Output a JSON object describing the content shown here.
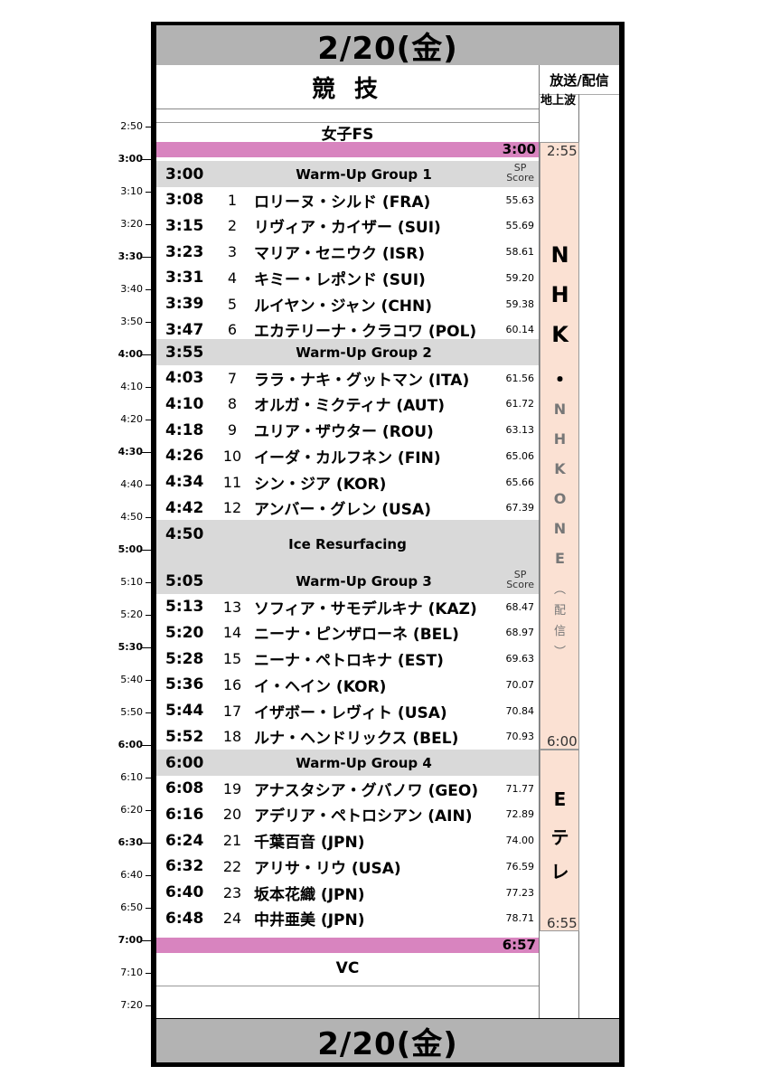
{
  "header": {
    "date_top": "2/20(金)",
    "date_bottom": "2/20(金)",
    "competition": "競 技",
    "broadcast": "放送/配信",
    "channel": "地上波"
  },
  "timeline": [
    "2:50",
    "3:00",
    "3:10",
    "3:20",
    "3:30",
    "3:40",
    "3:50",
    "4:00",
    "4:10",
    "4:20",
    "4:30",
    "4:40",
    "4:50",
    "5:00",
    "5:10",
    "5:20",
    "5:30",
    "5:40",
    "5:50",
    "6:00",
    "6:10",
    "6:20",
    "6:30",
    "6:40",
    "6:50",
    "7:00",
    "7:10",
    "7:20"
  ],
  "event_title": "女子FS",
  "start_marker": "3:00",
  "end_marker": "6:57",
  "sp_label": "SP\nScore",
  "groups": [
    {
      "time": "3:00",
      "label": "Warm-Up Group 1",
      "skaters": [
        {
          "time": "3:08",
          "num": "1",
          "name": "ロリーヌ・シルド (FRA)",
          "score": "55.63"
        },
        {
          "time": "3:15",
          "num": "2",
          "name": "リヴィア・カイザー (SUI)",
          "score": "55.69"
        },
        {
          "time": "3:23",
          "num": "3",
          "name": "マリア・セニウク (ISR)",
          "score": "58.61"
        },
        {
          "time": "3:31",
          "num": "4",
          "name": "キミー・レポンド (SUI)",
          "score": "59.20"
        },
        {
          "time": "3:39",
          "num": "5",
          "name": "ルイヤン・ジャン (CHN)",
          "score": "59.38"
        },
        {
          "time": "3:47",
          "num": "6",
          "name": "エカテリーナ・クラコワ (POL)",
          "score": "60.14"
        }
      ]
    },
    {
      "time": "3:55",
      "label": "Warm-Up Group 2",
      "skaters": [
        {
          "time": "4:03",
          "num": "7",
          "name": "ララ・ナキ・グットマン (ITA)",
          "score": "61.56"
        },
        {
          "time": "4:10",
          "num": "8",
          "name": "オルガ・ミクティナ (AUT)",
          "score": "61.72"
        },
        {
          "time": "4:18",
          "num": "9",
          "name": "ユリア・ザウター (ROU)",
          "score": "63.13"
        },
        {
          "time": "4:26",
          "num": "10",
          "name": "イーダ・カルフネン (FIN)",
          "score": "65.06"
        },
        {
          "time": "4:34",
          "num": "11",
          "name": "シン・ジア (KOR)",
          "score": "65.66"
        },
        {
          "time": "4:42",
          "num": "12",
          "name": "アンバー・グレン (USA)",
          "score": "67.39"
        }
      ]
    },
    {
      "time": "5:05",
      "label": "Warm-Up Group 3",
      "skaters": [
        {
          "time": "5:13",
          "num": "13",
          "name": "ソフィア・サモデルキナ (KAZ)",
          "score": "68.47"
        },
        {
          "time": "5:20",
          "num": "14",
          "name": "ニーナ・ピンザローネ (BEL)",
          "score": "68.97"
        },
        {
          "time": "5:28",
          "num": "15",
          "name": "ニーナ・ペトロキナ (EST)",
          "score": "69.63"
        },
        {
          "time": "5:36",
          "num": "16",
          "name": "イ・ヘイン (KOR)",
          "score": "70.07"
        },
        {
          "time": "5:44",
          "num": "17",
          "name": "イザボー・レヴィト (USA)",
          "score": "70.84"
        },
        {
          "time": "5:52",
          "num": "18",
          "name": "ルナ・ヘンドリックス (BEL)",
          "score": "70.93"
        }
      ]
    },
    {
      "time": "6:00",
      "label": "Warm-Up Group 4",
      "skaters": [
        {
          "time": "6:08",
          "num": "19",
          "name": "アナスタシア・グバノワ (GEO)",
          "score": "71.77"
        },
        {
          "time": "6:16",
          "num": "20",
          "name": "アデリア・ペトロシアン (AIN)",
          "score": "72.89"
        },
        {
          "time": "6:24",
          "num": "21",
          "name": "千葉百音 (JPN)",
          "score": "74.00"
        },
        {
          "time": "6:32",
          "num": "22",
          "name": "アリサ・リウ (USA)",
          "score": "76.59"
        },
        {
          "time": "6:40",
          "num": "23",
          "name": "坂本花織 (JPN)",
          "score": "77.23"
        },
        {
          "time": "6:48",
          "num": "24",
          "name": "中井亜美 (JPN)",
          "score": "78.71"
        }
      ]
    }
  ],
  "resurfacing": {
    "time": "4:50",
    "label": "Ice Resurfacing"
  },
  "closing": "VC",
  "broadcasts": [
    {
      "start": "2:55",
      "end": "6:00",
      "chars_big": [
        "N",
        "H",
        "K",
        "・"
      ],
      "chars_small": [
        "N",
        "H",
        "K",
        "O",
        "N",
        "E",
        "︵",
        "配",
        "信",
        "︶"
      ]
    },
    {
      "start": "",
      "end": "6:55",
      "chars_big": [
        "E",
        "テ",
        "レ"
      ]
    }
  ]
}
